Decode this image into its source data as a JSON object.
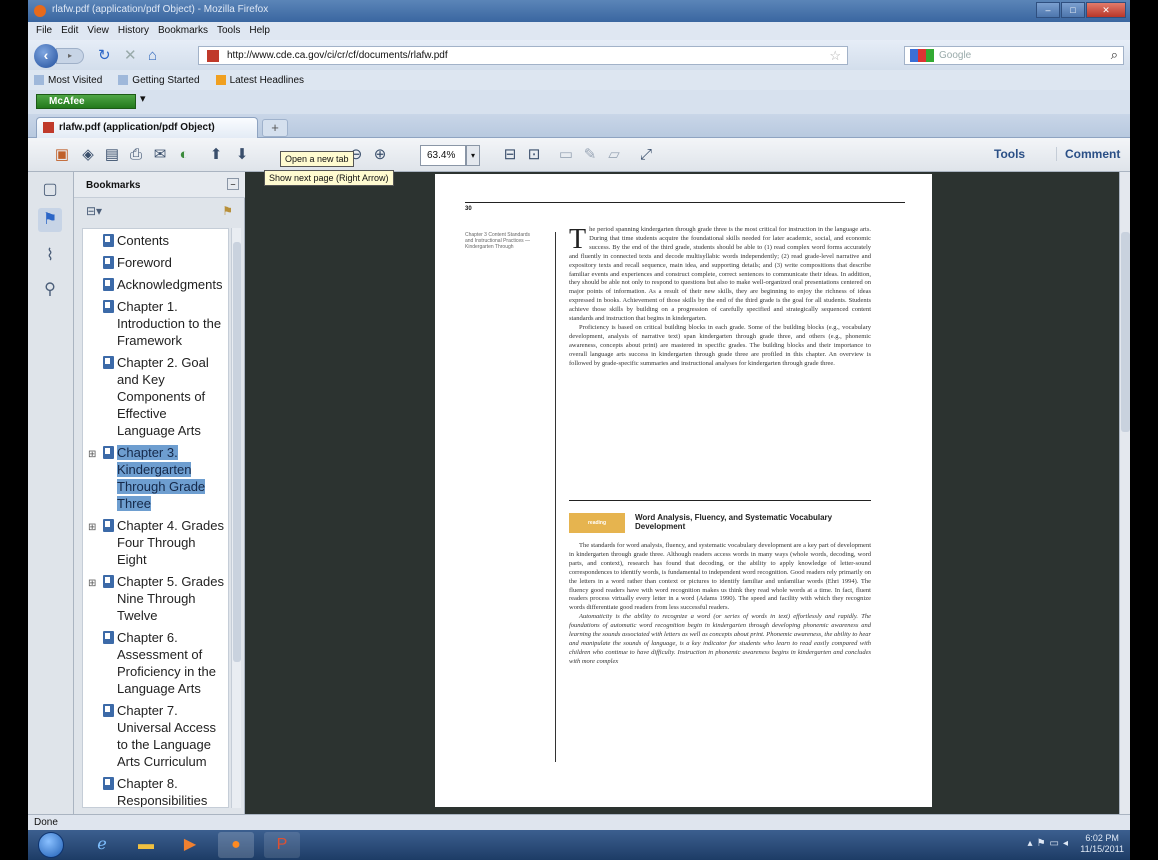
{
  "window": {
    "title": "rlafw.pdf (application/pdf Object) - Mozilla Firefox",
    "controls": [
      "–",
      "□",
      "✕"
    ]
  },
  "menu": [
    "File",
    "Edit",
    "View",
    "History",
    "Bookmarks",
    "Tools",
    "Help"
  ],
  "nav": {
    "url": "http://www.cde.ca.gov/ci/cr/cf/documents/rlafw.pdf",
    "search_placeholder": "Google"
  },
  "bookmarks_bar": [
    "Most Visited",
    "Getting Started",
    "Latest Headlines"
  ],
  "mcafee": {
    "label": "McAfee"
  },
  "tabs": [
    {
      "label": "rlafw.pdf (application/pdf Object)"
    }
  ],
  "newtab_label": "+",
  "pdf_toolbar": {
    "page_value": "30",
    "zoom": "63.4%",
    "tools": "Tools",
    "comment": "Comment",
    "tooltip_newtab": "Open a new tab",
    "tooltip_nextpage": "Show next page (Right Arrow)"
  },
  "bookmarks_panel": {
    "title": "Bookmarks",
    "items": [
      {
        "label": "Contents",
        "expandable": false,
        "selected": false
      },
      {
        "label": "Foreword",
        "expandable": false,
        "selected": false
      },
      {
        "label": "Acknowledgments",
        "expandable": false,
        "selected": false
      },
      {
        "label": "Chapter 1. Introduction to the Framework",
        "expandable": false,
        "selected": false
      },
      {
        "label": "Chapter 2. Goal and Key Components of Effective Language Arts",
        "expandable": false,
        "selected": false
      },
      {
        "label": "Chapter 3. Kindergarten Through Grade Three",
        "expandable": true,
        "selected": true
      },
      {
        "label": "Chapter 4. Grades Four Through Eight",
        "expandable": true,
        "selected": false
      },
      {
        "label": "Chapter 5. Grades Nine Through Twelve",
        "expandable": true,
        "selected": false
      },
      {
        "label": "Chapter 6. Assessment of Proficiency in the Language Arts",
        "expandable": false,
        "selected": false
      },
      {
        "label": "Chapter 7. Universal Access to the Language Arts Curriculum",
        "expandable": false,
        "selected": false
      },
      {
        "label": "Chapter 8. Responsibilities",
        "expandable": false,
        "selected": false
      }
    ]
  },
  "page": {
    "number": "30",
    "sidenote": "Chapter 3 Content Standards and Instructional Practices — Kindergarten Through",
    "dropcap": "T",
    "para1": "he period spanning kindergarten through grade three is the most critical for instruction in the language arts. During that time students acquire the foundational skills needed for later academic, social, and economic success. By the end of the third grade, students should be able to (1) read complex word forms accurately and fluently in connected texts and decode multisyllabic words independently; (2) read grade-level narrative and expository texts and recall sequence, main idea, and supporting details; and (3) write compositions that describe familiar events and experiences and construct complete, correct sentences to communicate their ideas. In addition, they should be able not only to respond to questions but also to make well-organized oral presentations centered on major points of information. As a result of their new skills, they are beginning to enjoy the richness of ideas expressed in books. Achievement of those skills by the end of the third grade is the goal for all students. Students achieve those skills by building on a progression of carefully specified and strategically sequenced content standards and instruction that begins in kindergarten.",
    "para2": "Proficiency is based on critical building blocks in each grade. Some of the building blocks (e.g., vocabulary development, analysis of narrative text) span kindergarten through grade three, and others (e.g., phonemic awareness, concepts about print) are mastered in specific grades. The building blocks and their importance to overall language arts success in kindergarten through grade three are profiled in this chapter. An overview is followed by grade-specific summaries and instructional analyses for kindergarten through grade three.",
    "badge": "reading",
    "section_title": "Word Analysis, Fluency, and Systematic Vocabulary Development",
    "para3": "The standards for word analysis, fluency, and systematic vocabulary development are a key part of development in kindergarten through grade three. Although readers access words in many ways (whole words, decoding, word parts, and context), research has found that decoding, or the ability to apply knowledge of letter-sound correspondences to identify words, is fundamental to independent word recognition. Good readers rely primarily on the letters in a word rather than context or pictures to identify familiar and unfamiliar words (Ehri 1994). The fluency good readers have with word recognition makes us think they read whole words at a time. In fact, fluent readers process virtually every letter in a word (Adams 1990). The speed and facility with which they recognize words differentiate good readers from less successful readers.",
    "para4": "Automaticity is the ability to recognize a word (or series of words in text) effortlessly and rapidly. The foundations of automatic word recognition begin in kindergarten through developing phonemic awareness and learning the sounds associated with letters as well as concepts about print. Phonemic awareness, the ability to hear and manipulate the sounds of language, is a key indicator for students who learn to read easily compared with children who continue to have difficulty. Instruction in phonemic awareness begins in kindergarten and concludes with more complex"
  },
  "status": "Done",
  "clock": {
    "time": "6:02 PM",
    "date": "11/15/2011"
  },
  "colors": {
    "selection": "#6e9ed0",
    "accent": "#2a4f86",
    "doc_bg": "#2c3330",
    "badge": "#e6b44f"
  }
}
